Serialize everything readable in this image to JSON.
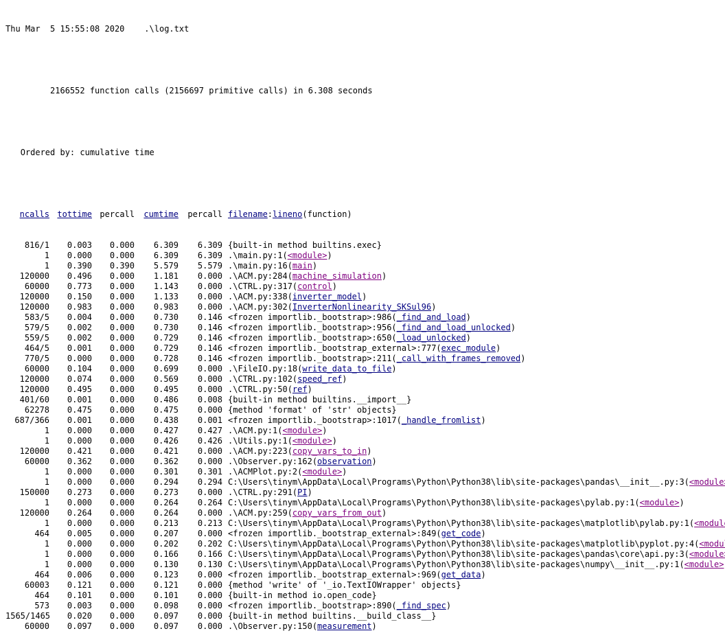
{
  "header": {
    "timestamp": "Thu Mar  5 15:55:08 2020",
    "file": ".\\log.txt",
    "summary": "2166552 function calls (2156697 primitive calls) in 6.308 seconds",
    "ordered_label": "Ordered by:",
    "ordered_value": "cumulative time"
  },
  "columns": {
    "ncalls": "ncalls",
    "tottime": "tottime",
    "percall1": "percall",
    "cumtime": "cumtime",
    "percall2": "percall",
    "filename": "filename",
    "lineno": "lineno",
    "function": "(function)"
  },
  "rows": [
    {
      "ncalls": "816/1",
      "tottime": "0.003",
      "percall1": "0.000",
      "cumtime": "6.309",
      "percall2": "6.309",
      "prefix": "{built-in method builtins.exec}",
      "link": "",
      "suffix": ""
    },
    {
      "ncalls": "1",
      "tottime": "0.000",
      "percall1": "0.000",
      "cumtime": "6.309",
      "percall2": "6.309",
      "prefix": ".\\main.py:1(",
      "link": "<module>",
      "suffix": ")"
    },
    {
      "ncalls": "1",
      "tottime": "0.390",
      "percall1": "0.390",
      "cumtime": "5.579",
      "percall2": "5.579",
      "prefix": ".\\main.py:16(",
      "link": "main",
      "suffix": ")"
    },
    {
      "ncalls": "120000",
      "tottime": "0.496",
      "percall1": "0.000",
      "cumtime": "1.181",
      "percall2": "0.000",
      "prefix": ".\\ACM.py:284(",
      "link": "machine_simulation",
      "suffix": ")"
    },
    {
      "ncalls": "60000",
      "tottime": "0.773",
      "percall1": "0.000",
      "cumtime": "1.143",
      "percall2": "0.000",
      "prefix": ".\\CTRL.py:317(",
      "link": "control",
      "suffix": ")"
    },
    {
      "ncalls": "120000",
      "tottime": "0.150",
      "percall1": "0.000",
      "cumtime": "1.133",
      "percall2": "0.000",
      "prefix": ".\\ACM.py:338(",
      "link": "inverter_model",
      "suffix": ")"
    },
    {
      "ncalls": "120000",
      "tottime": "0.983",
      "percall1": "0.000",
      "cumtime": "0.983",
      "percall2": "0.000",
      "prefix": ".\\ACM.py:302(",
      "link": "InverterNonlinearity_SKSul96",
      "suffix": ")"
    },
    {
      "ncalls": "583/5",
      "tottime": "0.004",
      "percall1": "0.000",
      "cumtime": "0.730",
      "percall2": "0.146",
      "prefix": "<frozen importlib._bootstrap>:986(",
      "link": "_find_and_load",
      "suffix": ")"
    },
    {
      "ncalls": "579/5",
      "tottime": "0.002",
      "percall1": "0.000",
      "cumtime": "0.730",
      "percall2": "0.146",
      "prefix": "<frozen importlib._bootstrap>:956(",
      "link": "_find_and_load_unlocked",
      "suffix": ")"
    },
    {
      "ncalls": "559/5",
      "tottime": "0.002",
      "percall1": "0.000",
      "cumtime": "0.729",
      "percall2": "0.146",
      "prefix": "<frozen importlib._bootstrap>:650(",
      "link": "_load_unlocked",
      "suffix": ")"
    },
    {
      "ncalls": "464/5",
      "tottime": "0.001",
      "percall1": "0.000",
      "cumtime": "0.729",
      "percall2": "0.146",
      "prefix": "<frozen importlib._bootstrap_external>:777(",
      "link": "exec_module",
      "suffix": ")"
    },
    {
      "ncalls": "770/5",
      "tottime": "0.000",
      "percall1": "0.000",
      "cumtime": "0.728",
      "percall2": "0.146",
      "prefix": "<frozen importlib._bootstrap>:211(",
      "link": "_call_with_frames_removed",
      "suffix": ")"
    },
    {
      "ncalls": "60000",
      "tottime": "0.104",
      "percall1": "0.000",
      "cumtime": "0.699",
      "percall2": "0.000",
      "prefix": ".\\FileIO.py:18(",
      "link": "write_data_to_file",
      "suffix": ")"
    },
    {
      "ncalls": "120000",
      "tottime": "0.074",
      "percall1": "0.000",
      "cumtime": "0.569",
      "percall2": "0.000",
      "prefix": ".\\CTRL.py:102(",
      "link": "speed_ref",
      "suffix": ")"
    },
    {
      "ncalls": "120000",
      "tottime": "0.495",
      "percall1": "0.000",
      "cumtime": "0.495",
      "percall2": "0.000",
      "prefix": ".\\CTRL.py:50(",
      "link": "ref",
      "suffix": ")"
    },
    {
      "ncalls": "401/60",
      "tottime": "0.001",
      "percall1": "0.000",
      "cumtime": "0.486",
      "percall2": "0.008",
      "prefix": "{built-in method builtins.__import__}",
      "link": "",
      "suffix": ""
    },
    {
      "ncalls": "62278",
      "tottime": "0.475",
      "percall1": "0.000",
      "cumtime": "0.475",
      "percall2": "0.000",
      "prefix": "{method 'format' of 'str' objects}",
      "link": "",
      "suffix": ""
    },
    {
      "ncalls": "687/366",
      "tottime": "0.001",
      "percall1": "0.000",
      "cumtime": "0.438",
      "percall2": "0.001",
      "prefix": "<frozen importlib._bootstrap>:1017(",
      "link": "_handle_fromlist",
      "suffix": ")"
    },
    {
      "ncalls": "1",
      "tottime": "0.000",
      "percall1": "0.000",
      "cumtime": "0.427",
      "percall2": "0.427",
      "prefix": ".\\ACM.py:1(",
      "link": "<module>",
      "suffix": ")"
    },
    {
      "ncalls": "1",
      "tottime": "0.000",
      "percall1": "0.000",
      "cumtime": "0.426",
      "percall2": "0.426",
      "prefix": ".\\Utils.py:1(",
      "link": "<module>",
      "suffix": ")"
    },
    {
      "ncalls": "120000",
      "tottime": "0.421",
      "percall1": "0.000",
      "cumtime": "0.421",
      "percall2": "0.000",
      "prefix": ".\\ACM.py:223(",
      "link": "copy_vars_to_in",
      "suffix": ")"
    },
    {
      "ncalls": "60000",
      "tottime": "0.362",
      "percall1": "0.000",
      "cumtime": "0.362",
      "percall2": "0.000",
      "prefix": ".\\Observer.py:162(",
      "link": "observation",
      "suffix": ")"
    },
    {
      "ncalls": "1",
      "tottime": "0.000",
      "percall1": "0.000",
      "cumtime": "0.301",
      "percall2": "0.301",
      "prefix": ".\\ACMPlot.py:2(",
      "link": "<module>",
      "suffix": ")"
    },
    {
      "ncalls": "1",
      "tottime": "0.000",
      "percall1": "0.000",
      "cumtime": "0.294",
      "percall2": "0.294",
      "prefix": "C:\\Users\\tinym\\AppData\\Local\\Programs\\Python\\Python38\\lib\\site-packages\\pandas\\__init__.py:3(",
      "link": "<module>",
      "suffix": ")"
    },
    {
      "ncalls": "150000",
      "tottime": "0.273",
      "percall1": "0.000",
      "cumtime": "0.273",
      "percall2": "0.000",
      "prefix": ".\\CTRL.py:291(",
      "link": "PI",
      "suffix": ")"
    },
    {
      "ncalls": "1",
      "tottime": "0.000",
      "percall1": "0.000",
      "cumtime": "0.264",
      "percall2": "0.264",
      "prefix": "C:\\Users\\tinym\\AppData\\Local\\Programs\\Python\\Python38\\lib\\site-packages\\pylab.py:1(",
      "link": "<module>",
      "suffix": ")"
    },
    {
      "ncalls": "120000",
      "tottime": "0.264",
      "percall1": "0.000",
      "cumtime": "0.264",
      "percall2": "0.000",
      "prefix": ".\\ACM.py:259(",
      "link": "copy_vars_from_out",
      "suffix": ")"
    },
    {
      "ncalls": "1",
      "tottime": "0.000",
      "percall1": "0.000",
      "cumtime": "0.213",
      "percall2": "0.213",
      "prefix": "C:\\Users\\tinym\\AppData\\Local\\Programs\\Python\\Python38\\lib\\site-packages\\matplotlib\\pylab.py:1(",
      "link": "<module>",
      "suffix": ")"
    },
    {
      "ncalls": "464",
      "tottime": "0.005",
      "percall1": "0.000",
      "cumtime": "0.207",
      "percall2": "0.000",
      "prefix": "<frozen importlib._bootstrap_external>:849(",
      "link": "get_code",
      "suffix": ")"
    },
    {
      "ncalls": "1",
      "tottime": "0.000",
      "percall1": "0.000",
      "cumtime": "0.202",
      "percall2": "0.202",
      "prefix": "C:\\Users\\tinym\\AppData\\Local\\Programs\\Python\\Python38\\lib\\site-packages\\matplotlib\\pyplot.py:4(",
      "link": "<module>",
      "suffix": ")"
    },
    {
      "ncalls": "1",
      "tottime": "0.000",
      "percall1": "0.000",
      "cumtime": "0.166",
      "percall2": "0.166",
      "prefix": "C:\\Users\\tinym\\AppData\\Local\\Programs\\Python\\Python38\\lib\\site-packages\\pandas\\core\\api.py:3(",
      "link": "<module>",
      "suffix": ")"
    },
    {
      "ncalls": "1",
      "tottime": "0.000",
      "percall1": "0.000",
      "cumtime": "0.130",
      "percall2": "0.130",
      "prefix": "C:\\Users\\tinym\\AppData\\Local\\Programs\\Python\\Python38\\lib\\site-packages\\numpy\\__init__.py:1(",
      "link": "<module>",
      "suffix": ")"
    },
    {
      "ncalls": "464",
      "tottime": "0.006",
      "percall1": "0.000",
      "cumtime": "0.123",
      "percall2": "0.000",
      "prefix": "<frozen importlib._bootstrap_external>:969(",
      "link": "get_data",
      "suffix": ")"
    },
    {
      "ncalls": "60003",
      "tottime": "0.121",
      "percall1": "0.000",
      "cumtime": "0.121",
      "percall2": "0.000",
      "prefix": "{method 'write' of '_io.TextIOWrapper' objects}",
      "link": "",
      "suffix": ""
    },
    {
      "ncalls": "464",
      "tottime": "0.101",
      "percall1": "0.000",
      "cumtime": "0.101",
      "percall2": "0.000",
      "prefix": "{built-in method io.open_code}",
      "link": "",
      "suffix": ""
    },
    {
      "ncalls": "573",
      "tottime": "0.003",
      "percall1": "0.000",
      "cumtime": "0.098",
      "percall2": "0.000",
      "prefix": "<frozen importlib._bootstrap>:890(",
      "link": "_find_spec",
      "suffix": ")"
    },
    {
      "ncalls": "1565/1465",
      "tottime": "0.020",
      "percall1": "0.000",
      "cumtime": "0.097",
      "percall2": "0.000",
      "prefix": "{built-in method builtins.__build_class__}",
      "link": "",
      "suffix": ""
    },
    {
      "ncalls": "60000",
      "tottime": "0.097",
      "percall1": "0.000",
      "cumtime": "0.097",
      "percall2": "0.000",
      "prefix": ".\\Observer.py:150(",
      "link": "measurement",
      "suffix": ")"
    }
  ]
}
